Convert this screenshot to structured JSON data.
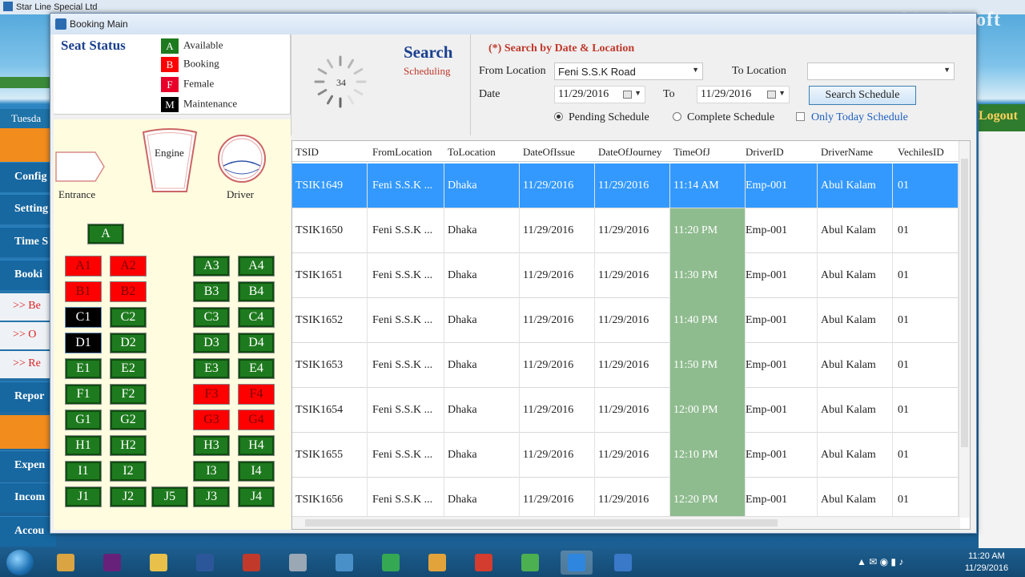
{
  "background_app": {
    "title": "Star Line Special Ltd",
    "brand": "Shimul Isoft",
    "date_label": "Tuesda",
    "logout": "Logout",
    "menu": [
      "Config",
      "Setting",
      "Time S",
      "Booki",
      "Repor",
      "Expen",
      "Incom",
      "Accou"
    ],
    "submenu": [
      ">> Be",
      ">> O",
      ">> Re"
    ]
  },
  "dialog": {
    "title": "Booking Main"
  },
  "seat_status": {
    "title": "Seat Status",
    "legend": [
      {
        "code": "A",
        "label": "Available",
        "color": "#1e7a1e"
      },
      {
        "code": "B",
        "label": "Booking",
        "color": "#ff0000"
      },
      {
        "code": "F",
        "label": "Female",
        "color": "#e8002a"
      },
      {
        "code": "M",
        "label": "Maintenance",
        "color": "#000000"
      }
    ]
  },
  "seatmap": {
    "entrance": "Entrance",
    "engine": "Engine",
    "driver": "Driver",
    "seats": {
      "A": "A",
      "A1": "A1",
      "A2": "A2",
      "A3": "A3",
      "A4": "A4",
      "B1": "B1",
      "B2": "B2",
      "B3": "B3",
      "B4": "B4",
      "C1": "C1",
      "C2": "C2",
      "C3": "C3",
      "C4": "C4",
      "D1": "D1",
      "D2": "D2",
      "D3": "D3",
      "D4": "D4",
      "E1": "E1",
      "E2": "E2",
      "E3": "E3",
      "E4": "E4",
      "F1": "F1",
      "F2": "F2",
      "F3": "F3",
      "F4": "F4",
      "G1": "G1",
      "G2": "G2",
      "G3": "G3",
      "G4": "G4",
      "H1": "H1",
      "H2": "H2",
      "H3": "H3",
      "H4": "H4",
      "I1": "I1",
      "I2": "I2",
      "I3": "I3",
      "I4": "I4",
      "J1": "J1",
      "J2": "J2",
      "J5": "J5",
      "J3": "J3",
      "J4": "J4"
    }
  },
  "search_panel": {
    "spinner_value": "34",
    "title": "Search",
    "subtitle": "Scheduling"
  },
  "filters": {
    "heading": "(*) Search by Date & Location",
    "from_location_label": "From Location",
    "from_location_value": "Feni S.S.K Road",
    "to_location_label": "To Location",
    "to_location_value": "",
    "date_label": "Date",
    "date_from": "11/29/2016",
    "to_label": "To",
    "date_to": "11/29/2016",
    "search_button": "Search Schedule",
    "pending": "Pending Schedule",
    "complete": "Complete Schedule",
    "only_today": "Only Today Schedule"
  },
  "grid": {
    "columns": [
      "TSID",
      "FromLocation",
      "ToLocation",
      "DateOfIssue",
      "DateOfJourney",
      "TimeOfJ",
      "DriverID",
      "DriverName",
      "VechilesID"
    ],
    "rows": [
      [
        "TSIK1649",
        "Feni S.S.K ...",
        "Dhaka",
        "11/29/2016",
        "11/29/2016",
        "11:14 AM",
        "Emp-001",
        "Abul Kalam",
        "01"
      ],
      [
        "TSIK1650",
        "Feni S.S.K ...",
        "Dhaka",
        "11/29/2016",
        "11/29/2016",
        "11:20 PM",
        "Emp-001",
        "Abul Kalam",
        "01"
      ],
      [
        "TSIK1651",
        "Feni S.S.K ...",
        "Dhaka",
        "11/29/2016",
        "11/29/2016",
        "11:30 PM",
        "Emp-001",
        "Abul Kalam",
        "01"
      ],
      [
        "TSIK1652",
        "Feni S.S.K ...",
        "Dhaka",
        "11/29/2016",
        "11/29/2016",
        "11:40 PM",
        "Emp-001",
        "Abul Kalam",
        "01"
      ],
      [
        "TSIK1653",
        "Feni S.S.K ...",
        "Dhaka",
        "11/29/2016",
        "11/29/2016",
        "11:50 PM",
        "Emp-001",
        "Abul Kalam",
        "01"
      ],
      [
        "TSIK1654",
        "Feni S.S.K ...",
        "Dhaka",
        "11/29/2016",
        "11/29/2016",
        "12:00 PM",
        "Emp-001",
        "Abul Kalam",
        "01"
      ],
      [
        "TSIK1655",
        "Feni S.S.K ...",
        "Dhaka",
        "11/29/2016",
        "11/29/2016",
        "12:10 PM",
        "Emp-001",
        "Abul Kalam",
        "01"
      ],
      [
        "TSIK1656",
        "Feni S.S.K ...",
        "Dhaka",
        "11/29/2016",
        "11/29/2016",
        "12:20 PM",
        "Emp-001",
        "Abul Kalam",
        "01"
      ]
    ]
  },
  "taskbar": {
    "time": "11:20 AM",
    "date": "11/29/2016",
    "apps": [
      {
        "name": "explorer-tools",
        "color": "#d9a441"
      },
      {
        "name": "visual-studio",
        "color": "#68217a"
      },
      {
        "name": "file-explorer",
        "color": "#e8c04a"
      },
      {
        "name": "word",
        "color": "#2b579a"
      },
      {
        "name": "paint",
        "color": "#c0392b"
      },
      {
        "name": "calculator",
        "color": "#9aa7b4"
      },
      {
        "name": "sql-tool",
        "color": "#4a90c8"
      },
      {
        "name": "chrome",
        "color": "#34a853"
      },
      {
        "name": "network",
        "color": "#e3a33b"
      },
      {
        "name": "paint-tool",
        "color": "#d33c2f"
      },
      {
        "name": "cubes",
        "color": "#4caf50"
      },
      {
        "name": "bus-app",
        "color": "#2e86de"
      },
      {
        "name": "home-app",
        "color": "#3a78c8"
      }
    ]
  }
}
